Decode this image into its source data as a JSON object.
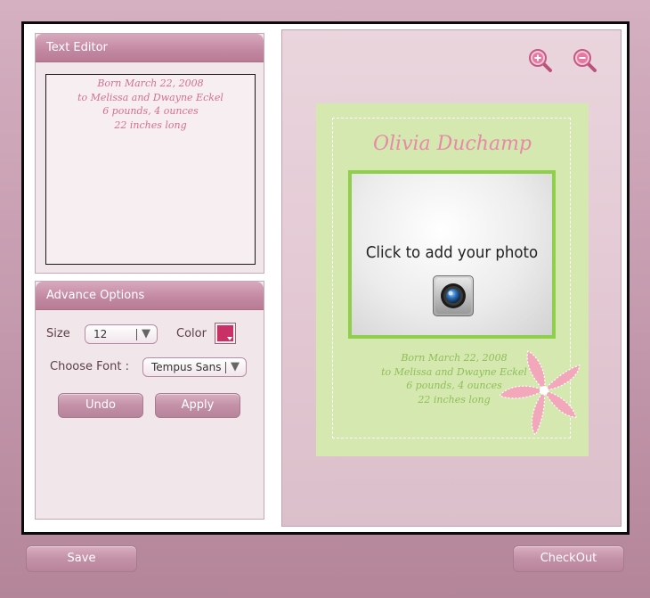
{
  "text_editor": {
    "header": "Text Editor",
    "lines": [
      "Born March 22, 2008",
      "to Melissa and Dwayne Eckel",
      "6 pounds, 4 ounces",
      "22 inches long"
    ]
  },
  "advance_options": {
    "header": "Advance Options",
    "size_label": "Size",
    "size_value": "12",
    "color_label": "Color",
    "color_value": "#c93065",
    "font_label": "Choose Font :",
    "font_value": "Tempus Sans",
    "undo_label": "Undo",
    "apply_label": "Apply"
  },
  "preview": {
    "zoom_in_icon": "zoom-in-icon",
    "zoom_out_icon": "zoom-out-icon",
    "card_title": "Olivia Duchamp",
    "photo_prompt": "Click to add your photo",
    "camera_icon": "camera-icon",
    "card_lines": [
      "Born March 22, 2008",
      "to Melissa and Dwayne Eckel",
      "6 pounds, 4 ounces",
      "22 inches long"
    ],
    "card_color": "#d4e8b0",
    "title_color": "#e68aa7",
    "text_color": "#8fbf59"
  },
  "footer": {
    "save_label": "Save",
    "checkout_label": "CheckOut"
  }
}
